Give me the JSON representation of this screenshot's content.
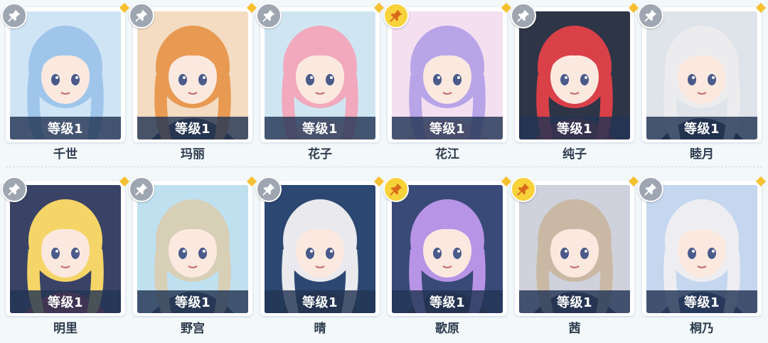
{
  "colors": {
    "pin_active": "#f7d23a",
    "pin_inactive": "#9ea6b2",
    "level_bar": "#223454",
    "corner_marker": "#f6c030"
  },
  "characters": [
    {
      "name": "千世",
      "level": "等级1",
      "pinned": false,
      "palette": [
        "#cfe4f5",
        "#9fc6ea",
        "#e6eef7"
      ]
    },
    {
      "name": "玛丽",
      "level": "等级1",
      "pinned": false,
      "palette": [
        "#f3dcc2",
        "#e89a52",
        "#3b3a3e"
      ]
    },
    {
      "name": "花子",
      "level": "等级1",
      "pinned": false,
      "palette": [
        "#cfe6f2",
        "#f2a9bd",
        "#f7d5df"
      ]
    },
    {
      "name": "花江",
      "level": "等级1",
      "pinned": true,
      "palette": [
        "#f4dff0",
        "#b7a5e8",
        "#f5c3d6"
      ]
    },
    {
      "name": "纯子",
      "level": "等级1",
      "pinned": false,
      "palette": [
        "#2d3547",
        "#d94048",
        "#8f2c38"
      ]
    },
    {
      "name": "睦月",
      "level": "等级1",
      "pinned": false,
      "palette": [
        "#dfe3ea",
        "#ececef",
        "#2b2b36"
      ]
    },
    {
      "name": "明里",
      "level": "等级1",
      "pinned": false,
      "palette": [
        "#3a4366",
        "#f5d567",
        "#c0394a"
      ]
    },
    {
      "name": "野宫",
      "level": "等级1",
      "pinned": false,
      "palette": [
        "#bfe0ef",
        "#d8cfb7",
        "#3f4a57"
      ]
    },
    {
      "name": "晴",
      "level": "等级1",
      "pinned": false,
      "palette": [
        "#2c4872",
        "#e9e9ee",
        "#2f3444"
      ]
    },
    {
      "name": "歌原",
      "level": "等级1",
      "pinned": true,
      "palette": [
        "#3a4a78",
        "#b794e6",
        "#33304a"
      ]
    },
    {
      "name": "茜",
      "level": "等级1",
      "pinned": true,
      "palette": [
        "#cfd2dc",
        "#c9b9a4",
        "#3a3a44"
      ]
    },
    {
      "name": "桐乃",
      "level": "等级1",
      "pinned": false,
      "palette": [
        "#c5d7ee",
        "#eeeeF2",
        "#3f4d7a"
      ]
    }
  ]
}
